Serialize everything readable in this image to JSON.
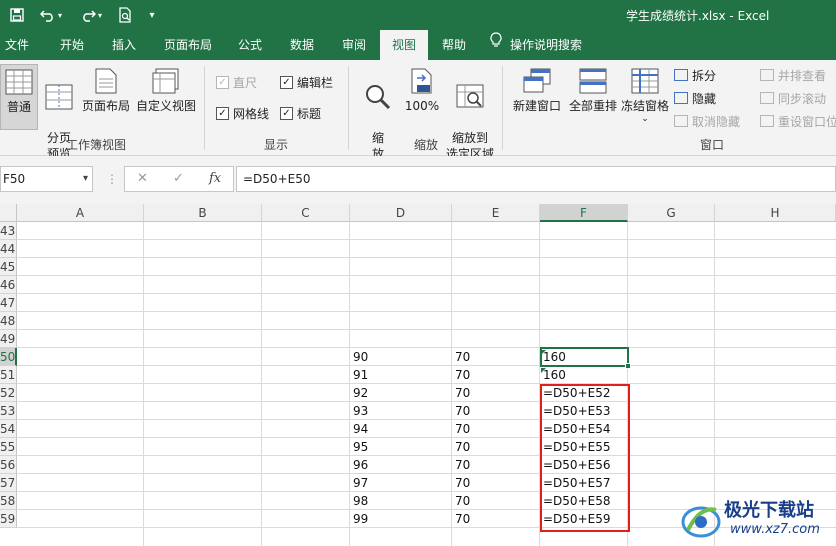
{
  "window": {
    "title": "学生成绩统计.xlsx  -  Excel",
    "qat": {
      "save_icon": "save-icon",
      "undo_icon": "undo-icon",
      "redo_icon": "redo-icon",
      "preview_icon": "print-preview-icon",
      "customize_icon": "qat-customize-icon"
    }
  },
  "tabs": [
    "文件",
    "开始",
    "插入",
    "页面布局",
    "公式",
    "数据",
    "审阅",
    "视图",
    "帮助",
    "操作说明搜索"
  ],
  "active_tab": "视图",
  "ribbon": {
    "workbook_views": {
      "label": "工作簿视图",
      "normal": "普通",
      "page_break": "分页\n预览",
      "page_layout": "页面布局",
      "custom": "自定义视图"
    },
    "show": {
      "label": "显示",
      "ruler": "直尺",
      "formula_bar": "编辑栏",
      "gridlines": "网格线",
      "headings": "标题"
    },
    "zoom": {
      "label": "缩放",
      "zoom": "缩\n放",
      "hundred": "100%",
      "zoom_to_selection": "缩放到\n选定区域"
    },
    "window": {
      "label": "窗口",
      "new_window": "新建窗口",
      "arrange_all": "全部重排",
      "freeze_panes": "冻结窗格",
      "split": "拆分",
      "hide": "隐藏",
      "unhide": "取消隐藏",
      "side_by_side": "并排查看",
      "sync_scroll": "同步滚动",
      "reset_position": "重设窗口位"
    }
  },
  "formula_bar": {
    "name_box": "F50",
    "formula": "=D50+E50"
  },
  "columns": [
    "A",
    "B",
    "C",
    "D",
    "E",
    "F",
    "G",
    "H"
  ],
  "active_column": "F",
  "rows": [
    "43",
    "44",
    "45",
    "46",
    "47",
    "48",
    "49",
    "50",
    "51",
    "52",
    "53",
    "54",
    "55",
    "56",
    "57",
    "58",
    "59"
  ],
  "active_row": "50",
  "cells": [
    {
      "row": "50",
      "D": "90",
      "E": "70",
      "F": "160"
    },
    {
      "row": "51",
      "D": "91",
      "E": "70",
      "F": "160"
    },
    {
      "row": "52",
      "D": "92",
      "E": "70",
      "F": "=D50+E52"
    },
    {
      "row": "53",
      "D": "93",
      "E": "70",
      "F": "=D50+E53"
    },
    {
      "row": "54",
      "D": "94",
      "E": "70",
      "F": "=D50+E54"
    },
    {
      "row": "55",
      "D": "95",
      "E": "70",
      "F": "=D50+E55"
    },
    {
      "row": "56",
      "D": "96",
      "E": "70",
      "F": "=D50+E56"
    },
    {
      "row": "57",
      "D": "97",
      "E": "70",
      "F": "=D50+E57"
    },
    {
      "row": "58",
      "D": "98",
      "E": "70",
      "F": "=D50+E58"
    },
    {
      "row": "59",
      "D": "99",
      "E": "70",
      "F": "=D50+E59"
    }
  ],
  "watermark": {
    "name": "极光下载站",
    "url": "www.xz7.com"
  },
  "colors": {
    "excel_green": "#217346",
    "highlight_red": "#e0201c"
  }
}
